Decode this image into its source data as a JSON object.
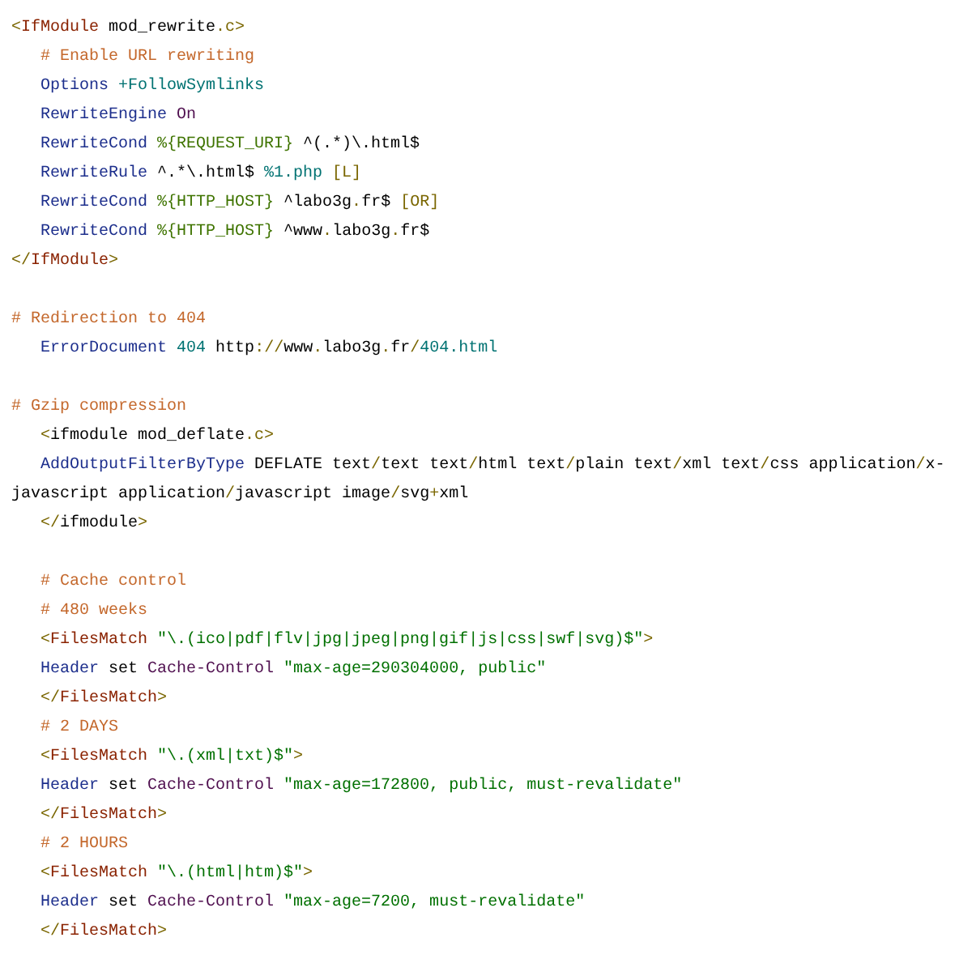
{
  "blocks": [
    {
      "lines": [
        [
          {
            "kind": "punct",
            "text": "<"
          },
          {
            "kind": "tag",
            "text": "IfModule"
          },
          {
            "kind": "plain",
            "text": " mod_rewrite"
          },
          {
            "kind": "punct",
            "text": ".c>"
          }
        ],
        [
          {
            "kind": "comment",
            "text": "   # Enable URL rewriting"
          }
        ],
        [
          {
            "kind": "directive",
            "text": "   Options "
          },
          {
            "kind": "value",
            "text": "+FollowSymlinks"
          }
        ],
        [
          {
            "kind": "directive",
            "text": "   RewriteEngine "
          },
          {
            "kind": "keyword",
            "text": "On"
          }
        ],
        [
          {
            "kind": "directive",
            "text": "   RewriteCond "
          },
          {
            "kind": "variable",
            "text": "%{REQUEST_URI}"
          },
          {
            "kind": "plain",
            "text": " ^(.*)\\.html$"
          }
        ],
        [
          {
            "kind": "directive",
            "text": "   RewriteRule"
          },
          {
            "kind": "plain",
            "text": " ^.*\\.html$ "
          },
          {
            "kind": "value",
            "text": "%1.php "
          },
          {
            "kind": "punct",
            "text": "[L]"
          }
        ],
        [
          {
            "kind": "directive",
            "text": "   RewriteCond "
          },
          {
            "kind": "variable",
            "text": "%{HTTP_HOST}"
          },
          {
            "kind": "plain",
            "text": " ^labo3g"
          },
          {
            "kind": "punct",
            "text": "."
          },
          {
            "kind": "plain",
            "text": "fr$ "
          },
          {
            "kind": "punct",
            "text": "[OR]"
          }
        ],
        [
          {
            "kind": "directive",
            "text": "   RewriteCond "
          },
          {
            "kind": "variable",
            "text": "%{HTTP_HOST}"
          },
          {
            "kind": "plain",
            "text": " ^www"
          },
          {
            "kind": "punct",
            "text": "."
          },
          {
            "kind": "plain",
            "text": "labo3g"
          },
          {
            "kind": "punct",
            "text": "."
          },
          {
            "kind": "plain",
            "text": "fr$"
          }
        ],
        [
          {
            "kind": "punct",
            "text": "</"
          },
          {
            "kind": "tag",
            "text": "IfModule"
          },
          {
            "kind": "punct",
            "text": ">"
          }
        ]
      ]
    },
    {
      "lines": [
        [
          {
            "kind": "comment",
            "text": "# Redirection to 404"
          }
        ],
        [
          {
            "kind": "directive",
            "text": "   ErrorDocument "
          },
          {
            "kind": "value",
            "text": "404"
          },
          {
            "kind": "plain",
            "text": " http"
          },
          {
            "kind": "punct",
            "text": "://"
          },
          {
            "kind": "plain",
            "text": "www"
          },
          {
            "kind": "punct",
            "text": "."
          },
          {
            "kind": "plain",
            "text": "labo3g"
          },
          {
            "kind": "punct",
            "text": "."
          },
          {
            "kind": "plain",
            "text": "fr"
          },
          {
            "kind": "punct",
            "text": "/"
          },
          {
            "kind": "value",
            "text": "404.html"
          }
        ]
      ]
    },
    {
      "lines": [
        [
          {
            "kind": "comment",
            "text": "# Gzip compression"
          }
        ],
        [
          {
            "kind": "punct",
            "text": "   <"
          },
          {
            "kind": "plain",
            "text": "ifmodule mod_deflate"
          },
          {
            "kind": "punct",
            "text": ".c>"
          }
        ],
        [
          {
            "kind": "directive",
            "text": "   AddOutputFilterByType"
          },
          {
            "kind": "plain",
            "text": " DEFLATE text"
          },
          {
            "kind": "punct",
            "text": "/"
          },
          {
            "kind": "plain",
            "text": "text text"
          },
          {
            "kind": "punct",
            "text": "/"
          },
          {
            "kind": "plain",
            "text": "html text"
          },
          {
            "kind": "punct",
            "text": "/"
          },
          {
            "kind": "plain",
            "text": "plain text"
          },
          {
            "kind": "punct",
            "text": "/"
          },
          {
            "kind": "plain",
            "text": "xml text"
          },
          {
            "kind": "punct",
            "text": "/"
          },
          {
            "kind": "plain",
            "text": "css application"
          },
          {
            "kind": "punct",
            "text": "/"
          },
          {
            "kind": "plain",
            "text": "x-"
          }
        ],
        [
          {
            "kind": "plain",
            "text": "javascript application"
          },
          {
            "kind": "punct",
            "text": "/"
          },
          {
            "kind": "plain",
            "text": "javascript image"
          },
          {
            "kind": "punct",
            "text": "/"
          },
          {
            "kind": "plain",
            "text": "svg"
          },
          {
            "kind": "punct",
            "text": "+"
          },
          {
            "kind": "plain",
            "text": "xml"
          }
        ],
        [
          {
            "kind": "punct",
            "text": "   </"
          },
          {
            "kind": "plain",
            "text": "ifmodule"
          },
          {
            "kind": "punct",
            "text": ">"
          }
        ]
      ]
    },
    {
      "lines": [
        [
          {
            "kind": "comment",
            "text": "   # Cache control"
          }
        ],
        [
          {
            "kind": "comment",
            "text": "   # 480 weeks"
          }
        ],
        [
          {
            "kind": "punct",
            "text": "   <"
          },
          {
            "kind": "tag",
            "text": "FilesMatch "
          },
          {
            "kind": "string",
            "text": "\"\\.(ico|pdf|flv|jpg|jpeg|png|gif|js|css|swf|svg)$\""
          },
          {
            "kind": "punct",
            "text": ">"
          }
        ],
        [
          {
            "kind": "directive",
            "text": "   Header"
          },
          {
            "kind": "plain",
            "text": " set "
          },
          {
            "kind": "keyword",
            "text": "Cache-Control "
          },
          {
            "kind": "string",
            "text": "\"max-age=290304000, public\""
          }
        ],
        [
          {
            "kind": "punct",
            "text": "   </"
          },
          {
            "kind": "tag",
            "text": "FilesMatch"
          },
          {
            "kind": "punct",
            "text": ">"
          }
        ],
        [
          {
            "kind": "comment",
            "text": "   # 2 DAYS"
          }
        ],
        [
          {
            "kind": "punct",
            "text": "   <"
          },
          {
            "kind": "tag",
            "text": "FilesMatch "
          },
          {
            "kind": "string",
            "text": "\"\\.(xml|txt)$\""
          },
          {
            "kind": "punct",
            "text": ">"
          }
        ],
        [
          {
            "kind": "directive",
            "text": "   Header"
          },
          {
            "kind": "plain",
            "text": " set "
          },
          {
            "kind": "keyword",
            "text": "Cache-Control "
          },
          {
            "kind": "string",
            "text": "\"max-age=172800, public, must-revalidate\""
          }
        ],
        [
          {
            "kind": "punct",
            "text": "   </"
          },
          {
            "kind": "tag",
            "text": "FilesMatch"
          },
          {
            "kind": "punct",
            "text": ">"
          }
        ],
        [
          {
            "kind": "comment",
            "text": "   # 2 HOURS"
          }
        ],
        [
          {
            "kind": "punct",
            "text": "   <"
          },
          {
            "kind": "tag",
            "text": "FilesMatch "
          },
          {
            "kind": "string",
            "text": "\"\\.(html|htm)$\""
          },
          {
            "kind": "punct",
            "text": ">"
          }
        ],
        [
          {
            "kind": "directive",
            "text": "   Header"
          },
          {
            "kind": "plain",
            "text": " set "
          },
          {
            "kind": "keyword",
            "text": "Cache-Control "
          },
          {
            "kind": "string",
            "text": "\"max-age=7200, must-revalidate\""
          }
        ],
        [
          {
            "kind": "punct",
            "text": "   </"
          },
          {
            "kind": "tag",
            "text": "FilesMatch"
          },
          {
            "kind": "punct",
            "text": ">"
          }
        ]
      ]
    }
  ]
}
